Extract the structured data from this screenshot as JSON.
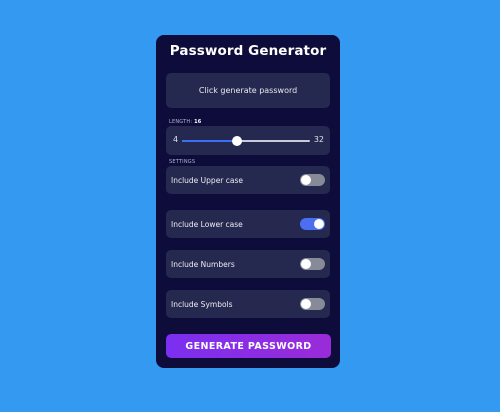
{
  "app": {
    "title": "Password Generator"
  },
  "output": {
    "text": "Click generate password"
  },
  "length": {
    "label": "Length:",
    "value": "16",
    "min": "4",
    "max": "32",
    "current": 16
  },
  "settings": {
    "label": "Settings",
    "items": [
      {
        "label": "Include Upper case",
        "enabled": false
      },
      {
        "label": "Include Lower case",
        "enabled": true
      },
      {
        "label": "Include Numbers",
        "enabled": false
      },
      {
        "label": "Include Symbols",
        "enabled": false
      }
    ]
  },
  "actions": {
    "generate_label": "Generate Password"
  },
  "colors": {
    "background": "#3399f1",
    "card": "#0d0c3a",
    "panel": "#26294f",
    "accent": "#4a6ff0",
    "button_gradient_start": "#7b2ff0",
    "button_gradient_end": "#9a2bd8"
  }
}
